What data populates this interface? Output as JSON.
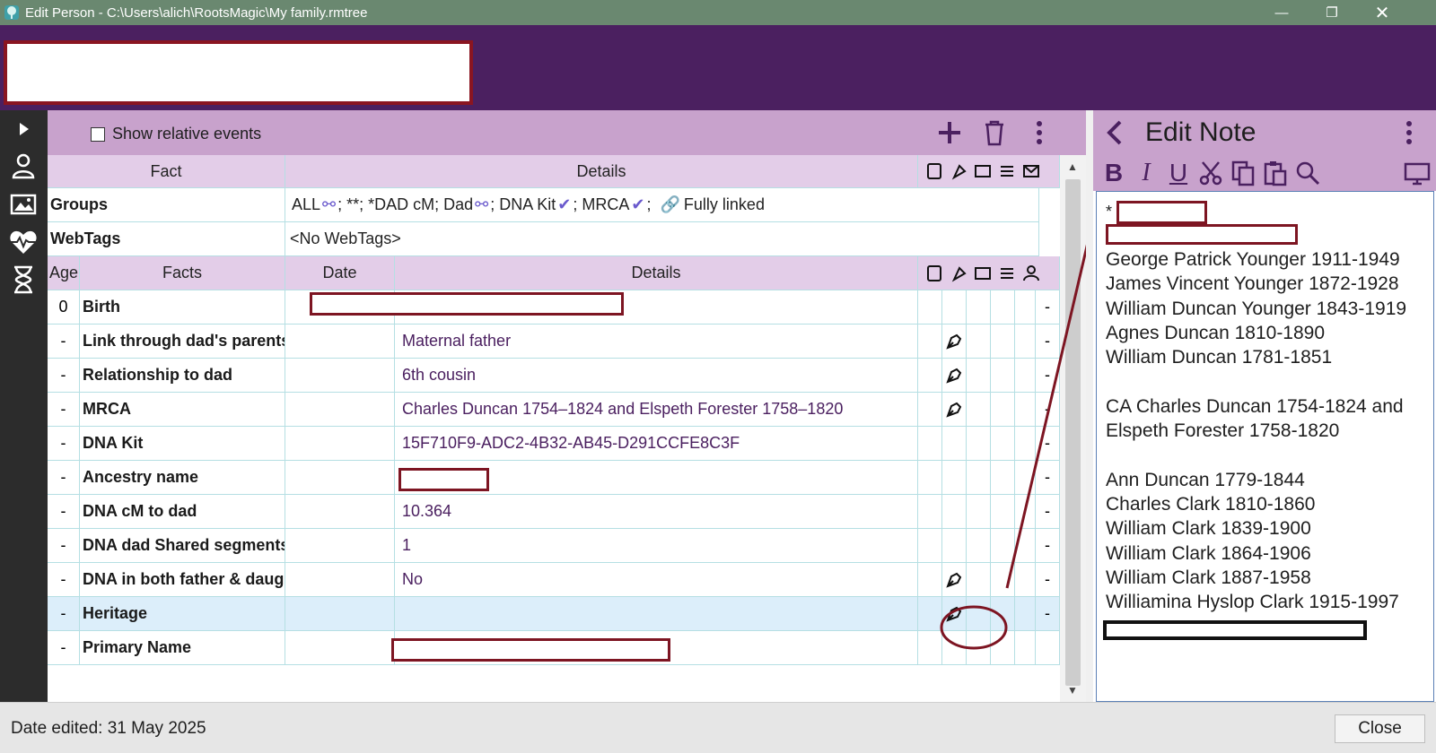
{
  "window": {
    "title": "Edit Person - C:\\Users\\alich\\RootsMagic\\My family.rmtree",
    "minimize_glyph": "—",
    "maximize_glyph": "❐",
    "close_glyph": "✕"
  },
  "toolbar": {
    "show_relative_events": "Show relative events"
  },
  "top_grid": {
    "headers": {
      "fact": "Fact",
      "details": "Details"
    },
    "rows": [
      {
        "label": "Groups",
        "details_parts": [
          "ALL",
          "; **; *DAD cM; Dad",
          "; DNA Kit",
          "; MRCA",
          ";",
          "Fully linked"
        ]
      },
      {
        "label": "WebTags",
        "details": "<No WebTags>"
      }
    ]
  },
  "facts_grid": {
    "headers": {
      "age": "Age",
      "facts": "Facts",
      "date": "Date",
      "details": "Details"
    },
    "rows": [
      {
        "age": "0",
        "fact": "Birth",
        "details": "",
        "has_note": false,
        "end": "-"
      },
      {
        "age": "-",
        "fact": "Link through dad's parents",
        "details": "Maternal father",
        "has_note": true,
        "end": "-"
      },
      {
        "age": "-",
        "fact": "Relationship to dad",
        "details": "6th cousin",
        "has_note": true,
        "end": "-"
      },
      {
        "age": "-",
        "fact": "MRCA",
        "details": "Charles Duncan 1754–1824 and Elspeth Forester 1758–1820",
        "has_note": true,
        "end": "-"
      },
      {
        "age": "-",
        "fact": "DNA Kit",
        "details": "15F710F9-ADC2-4B32-AB45-D291CCFE8C3F",
        "has_note": false,
        "end": "-"
      },
      {
        "age": "-",
        "fact": "Ancestry name",
        "details": "",
        "has_note": false,
        "end": "-"
      },
      {
        "age": "-",
        "fact": "DNA cM to dad",
        "details": "10.364",
        "has_note": false,
        "end": "-"
      },
      {
        "age": "-",
        "fact": "DNA dad Shared segments",
        "details": "1",
        "has_note": false,
        "end": "-"
      },
      {
        "age": "-",
        "fact": "DNA in both father & daughter",
        "details": "No",
        "has_note": true,
        "end": "-"
      },
      {
        "age": "-",
        "fact": "Heritage",
        "details": "",
        "has_note": true,
        "end": "-",
        "selected": true
      },
      {
        "age": "-",
        "fact": "Primary Name",
        "details": "",
        "has_note": false,
        "end": ""
      }
    ]
  },
  "note_panel": {
    "title": "Edit Note",
    "first_char": "*",
    "lines": [
      "George Patrick Younger 1911-1949",
      "James Vincent Younger 1872-1928",
      "William Duncan Younger 1843-1919",
      "Agnes Duncan 1810-1890",
      "William Duncan 1781-1851",
      "",
      "CA Charles Duncan 1754-1824 and",
      "Elspeth Forester 1758-1820",
      "",
      "Ann Duncan 1779-1844",
      "Charles Clark 1810-1860",
      "William Clark 1839-1900",
      "William Clark 1864-1906",
      "William Clark 1887-1958",
      "Williamina Hyslop Clark 1915-1997"
    ],
    "tools": {
      "bold": "B",
      "italic": "I",
      "underline": "U"
    }
  },
  "status": {
    "date_edited": "Date edited: 31 May 2025",
    "close_label": "Close"
  },
  "colors": {
    "header_purple": "#4b2060",
    "toolbar_lilac": "#c8a2cc",
    "column_header": "#e3cde8",
    "selected_row": "#dceefa",
    "redaction_red": "#7d1522",
    "title_bar": "#6a8870"
  }
}
